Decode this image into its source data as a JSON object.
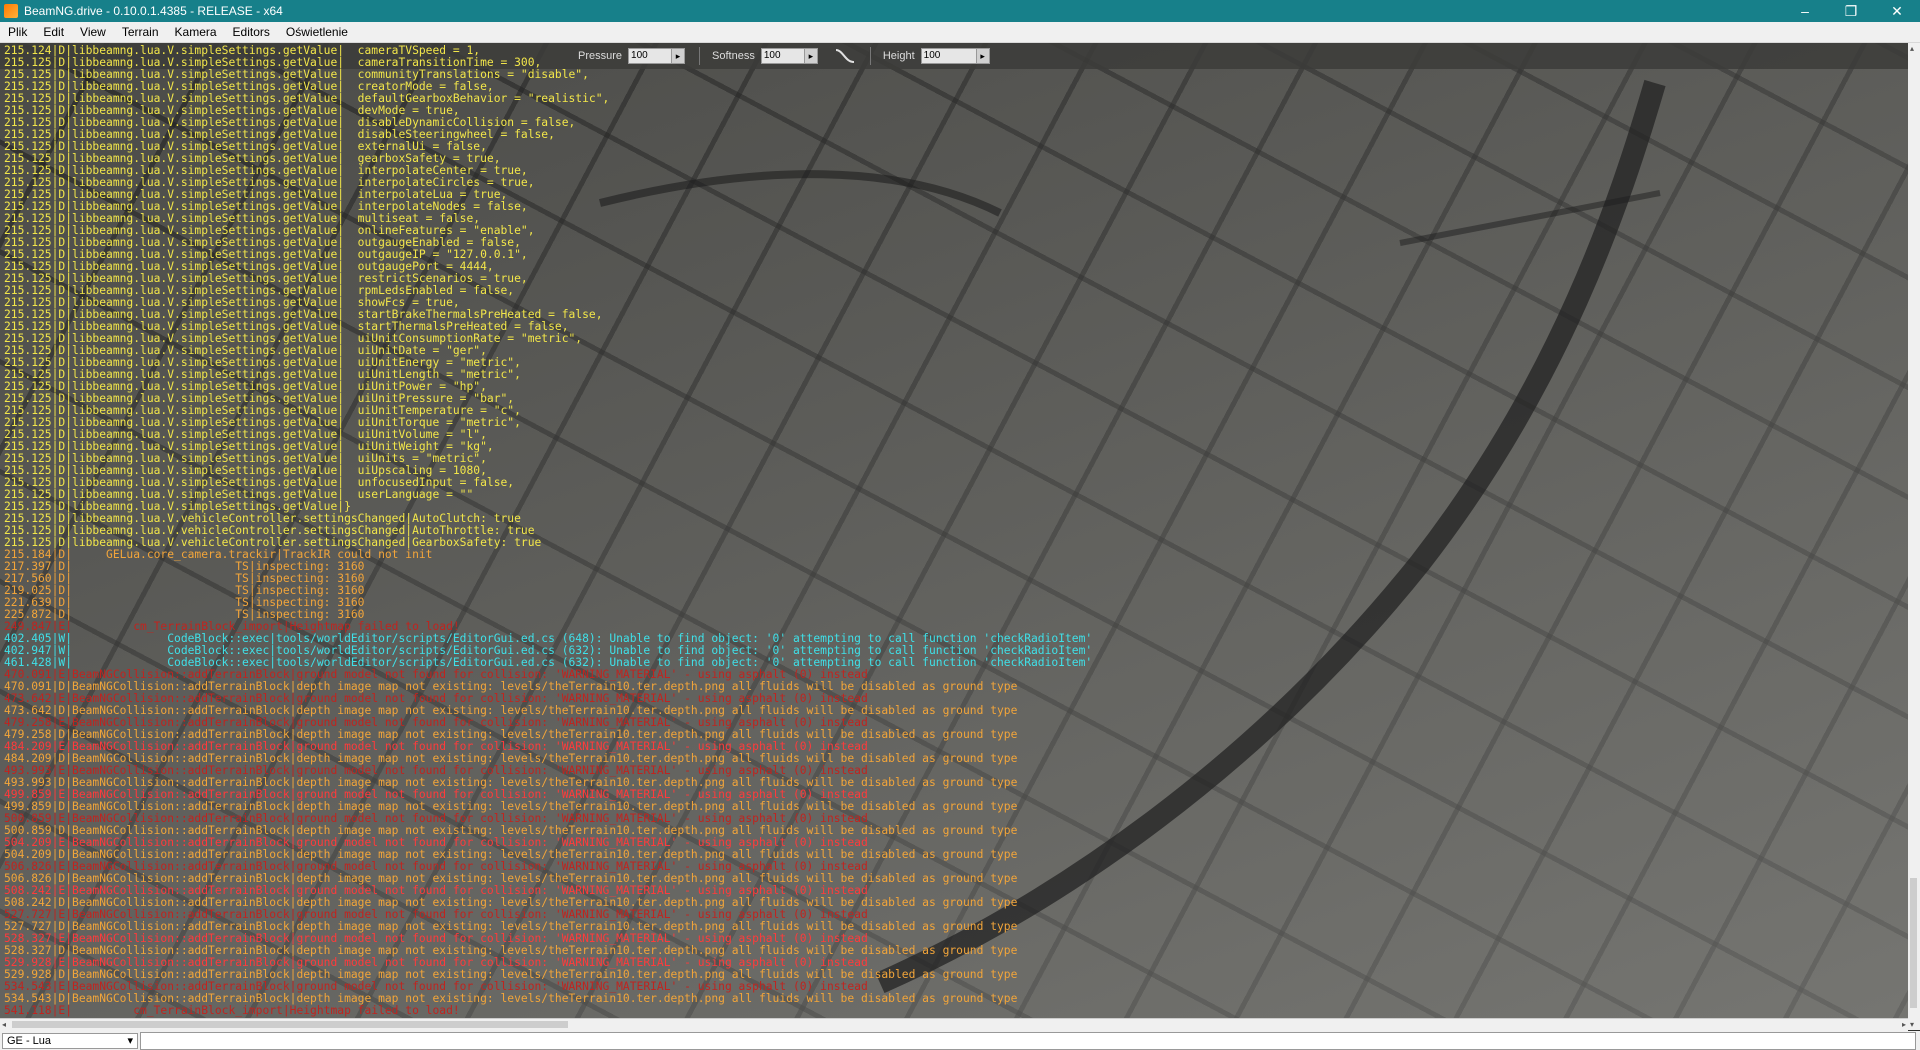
{
  "window": {
    "title": "BeamNG.drive - 0.10.0.1.4385 - RELEASE - x64",
    "minimize": "–",
    "maximize": "❐",
    "close": "✕"
  },
  "menu": [
    "Plik",
    "Edit",
    "View",
    "Terrain",
    "Kamera",
    "Editors",
    "Oświetlenie"
  ],
  "toolbar": {
    "pressure": {
      "label": "Pressure",
      "value": "100"
    },
    "softness": {
      "label": "Softness",
      "value": "100"
    },
    "height": {
      "label": "Height",
      "value": "100"
    }
  },
  "console_lines": [
    {
      "t": "215.124|D|libbeamng.lua.V.simpleSettings.getValue|  cameraTVSpeed = 1,",
      "c": "y"
    },
    {
      "t": "215.125|D|libbeamng.lua.V.simpleSettings.getValue|  cameraTransitionTime = 300,",
      "c": "y"
    },
    {
      "t": "215.125|D|libbeamng.lua.V.simpleSettings.getValue|  communityTranslations = \"disable\",",
      "c": "y"
    },
    {
      "t": "215.125|D|libbeamng.lua.V.simpleSettings.getValue|  creatorMode = false,",
      "c": "y"
    },
    {
      "t": "215.125|D|libbeamng.lua.V.simpleSettings.getValue|  defaultGearboxBehavior = \"realistic\",",
      "c": "y"
    },
    {
      "t": "215.125|D|libbeamng.lua.V.simpleSettings.getValue|  devMode = true,",
      "c": "y"
    },
    {
      "t": "215.125|D|libbeamng.lua.V.simpleSettings.getValue|  disableDynamicCollision = false,",
      "c": "y"
    },
    {
      "t": "215.125|D|libbeamng.lua.V.simpleSettings.getValue|  disableSteeringwheel = false,",
      "c": "y"
    },
    {
      "t": "215.125|D|libbeamng.lua.V.simpleSettings.getValue|  externalUi = false,",
      "c": "y"
    },
    {
      "t": "215.125|D|libbeamng.lua.V.simpleSettings.getValue|  gearboxSafety = true,",
      "c": "y"
    },
    {
      "t": "215.125|D|libbeamng.lua.V.simpleSettings.getValue|  interpolateCenter = true,",
      "c": "y"
    },
    {
      "t": "215.125|D|libbeamng.lua.V.simpleSettings.getValue|  interpolateCircles = true,",
      "c": "y"
    },
    {
      "t": "215.125|D|libbeamng.lua.V.simpleSettings.getValue|  interpolateLua = true,",
      "c": "y"
    },
    {
      "t": "215.125|D|libbeamng.lua.V.simpleSettings.getValue|  interpolateNodes = false,",
      "c": "y"
    },
    {
      "t": "215.125|D|libbeamng.lua.V.simpleSettings.getValue|  multiseat = false,",
      "c": "y"
    },
    {
      "t": "215.125|D|libbeamng.lua.V.simpleSettings.getValue|  onlineFeatures = \"enable\",",
      "c": "y"
    },
    {
      "t": "215.125|D|libbeamng.lua.V.simpleSettings.getValue|  outgaugeEnabled = false,",
      "c": "y"
    },
    {
      "t": "215.125|D|libbeamng.lua.V.simpleSettings.getValue|  outgaugeIP = \"127.0.0.1\",",
      "c": "y"
    },
    {
      "t": "215.125|D|libbeamng.lua.V.simpleSettings.getValue|  outgaugePort = 4444,",
      "c": "y"
    },
    {
      "t": "215.125|D|libbeamng.lua.V.simpleSettings.getValue|  restrictScenarios = true,",
      "c": "y"
    },
    {
      "t": "215.125|D|libbeamng.lua.V.simpleSettings.getValue|  rpmLedsEnabled = false,",
      "c": "y"
    },
    {
      "t": "215.125|D|libbeamng.lua.V.simpleSettings.getValue|  showFcs = true,",
      "c": "y"
    },
    {
      "t": "215.125|D|libbeamng.lua.V.simpleSettings.getValue|  startBrakeThermalsPreHeated = false,",
      "c": "y"
    },
    {
      "t": "215.125|D|libbeamng.lua.V.simpleSettings.getValue|  startThermalsPreHeated = false,",
      "c": "y"
    },
    {
      "t": "215.125|D|libbeamng.lua.V.simpleSettings.getValue|  uiUnitConsumptionRate = \"metric\",",
      "c": "y"
    },
    {
      "t": "215.125|D|libbeamng.lua.V.simpleSettings.getValue|  uiUnitDate = \"ger\",",
      "c": "y"
    },
    {
      "t": "215.125|D|libbeamng.lua.V.simpleSettings.getValue|  uiUnitEnergy = \"metric\",",
      "c": "y"
    },
    {
      "t": "215.125|D|libbeamng.lua.V.simpleSettings.getValue|  uiUnitLength = \"metric\",",
      "c": "y"
    },
    {
      "t": "215.125|D|libbeamng.lua.V.simpleSettings.getValue|  uiUnitPower = \"hp\",",
      "c": "y"
    },
    {
      "t": "215.125|D|libbeamng.lua.V.simpleSettings.getValue|  uiUnitPressure = \"bar\",",
      "c": "y"
    },
    {
      "t": "215.125|D|libbeamng.lua.V.simpleSettings.getValue|  uiUnitTemperature = \"c\",",
      "c": "y"
    },
    {
      "t": "215.125|D|libbeamng.lua.V.simpleSettings.getValue|  uiUnitTorque = \"metric\",",
      "c": "y"
    },
    {
      "t": "215.125|D|libbeamng.lua.V.simpleSettings.getValue|  uiUnitVolume = \"l\",",
      "c": "y"
    },
    {
      "t": "215.125|D|libbeamng.lua.V.simpleSettings.getValue|  uiUnitWeight = \"kg\",",
      "c": "y"
    },
    {
      "t": "215.125|D|libbeamng.lua.V.simpleSettings.getValue|  uiUnits = \"metric\",",
      "c": "y"
    },
    {
      "t": "215.125|D|libbeamng.lua.V.simpleSettings.getValue|  uiUpscaling = 1080,",
      "c": "y"
    },
    {
      "t": "215.125|D|libbeamng.lua.V.simpleSettings.getValue|  unfocusedInput = false,",
      "c": "y"
    },
    {
      "t": "215.125|D|libbeamng.lua.V.simpleSettings.getValue|  userLanguage = \"\"",
      "c": "y"
    },
    {
      "t": "215.125|D|libbeamng.lua.V.simpleSettings.getValue|}",
      "c": "y"
    },
    {
      "t": "215.125|D|libbeamng.lua.V.vehicleController.settingsChanged|AutoClutch: true",
      "c": "y"
    },
    {
      "t": "215.125|D|libbeamng.lua.V.vehicleController.settingsChanged|AutoThrottle: true",
      "c": "y"
    },
    {
      "t": "215.125|D|libbeamng.lua.V.vehicleController.settingsChanged|GearboxSafety: true",
      "c": "y"
    },
    {
      "t": "215.184|D|     GELua.core_camera.trackir|TrackIR could not init",
      "c": "o"
    },
    {
      "t": "217.397|D|                        TS|inspecting: 3160",
      "c": "o"
    },
    {
      "t": "217.560|D|                        TS|inspecting: 3160",
      "c": "o"
    },
    {
      "t": "219.025|D|                        TS|inspecting: 3160",
      "c": "o"
    },
    {
      "t": "221.639|D|                        TS|inspecting: 3160",
      "c": "o"
    },
    {
      "t": "225.872|D|                        TS|inspecting: 3160",
      "c": "o"
    },
    {
      "t": "249.847|E|         cm_TerrainBlock_import|Heightmap failed to load!",
      "c": "rd"
    },
    {
      "t": "402.405|W|              CodeBlock::exec|tools/worldEditor/scripts/EditorGui.ed.cs (648): Unable to find object: '0' attempting to call function 'checkRadioItem'",
      "c": "c"
    },
    {
      "t": "402.947|W|              CodeBlock::exec|tools/worldEditor/scripts/EditorGui.ed.cs (632): Unable to find object: '0' attempting to call function 'checkRadioItem'",
      "c": "c"
    },
    {
      "t": "461.428|W|              CodeBlock::exec|tools/worldEditor/scripts/EditorGui.ed.cs (632): Unable to find object: '0' attempting to call function 'checkRadioItem'",
      "c": "c"
    },
    {
      "t": "470.091|E|BeamNGCollision::addTerrainBlock|ground model not found for collision: 'WARNING_MATERIAL' - using asphalt (0) instead",
      "c": "rd"
    },
    {
      "t": "470.091|D|BeamNGCollision::addTerrainBlock|depth image map not existing: levels/theTerrain10.ter.depth.png all fluids will be disabled as ground type",
      "c": "o"
    },
    {
      "t": "473.642|E|BeamNGCollision::addTerrainBlock|ground model not found for collision: 'WARNING_MATERIAL' - using asphalt (0) instead",
      "c": "rd"
    },
    {
      "t": "473.642|D|BeamNGCollision::addTerrainBlock|depth image map not existing: levels/theTerrain10.ter.depth.png all fluids will be disabled as ground type",
      "c": "o"
    },
    {
      "t": "479.258|E|BeamNGCollision::addTerrainBlock|ground model not found for collision: 'WARNING_MATERIAL' - using asphalt (0) instead",
      "c": "rd"
    },
    {
      "t": "479.258|D|BeamNGCollision::addTerrainBlock|depth image map not existing: levels/theTerrain10.ter.depth.png all fluids will be disabled as ground type",
      "c": "o"
    },
    {
      "t": "484.209|E|BeamNGCollision::addTerrainBlock|ground model not found for collision: 'WARNING_MATERIAL' - using asphalt (0) instead",
      "c": "r"
    },
    {
      "t": "484.209|D|BeamNGCollision::addTerrainBlock|depth image map not existing: levels/theTerrain10.ter.depth.png all fluids will be disabled as ground type",
      "c": "o"
    },
    {
      "t": "493.993|E|BeamNGCollision::addTerrainBlock|ground model not found for collision: 'WARNING_MATERIAL' - using asphalt (0) instead",
      "c": "rd"
    },
    {
      "t": "493.993|D|BeamNGCollision::addTerrainBlock|depth image map not existing: levels/theTerrain10.ter.depth.png all fluids will be disabled as ground type",
      "c": "o"
    },
    {
      "t": "499.859|E|BeamNGCollision::addTerrainBlock|ground model not found for collision: 'WARNING_MATERIAL' - using asphalt (0) instead",
      "c": "r"
    },
    {
      "t": "499.859|D|BeamNGCollision::addTerrainBlock|depth image map not existing: levels/theTerrain10.ter.depth.png all fluids will be disabled as ground type",
      "c": "o"
    },
    {
      "t": "500.859|E|BeamNGCollision::addTerrainBlock|ground model not found for collision: 'WARNING_MATERIAL' - using asphalt (0) instead",
      "c": "rd"
    },
    {
      "t": "500.859|D|BeamNGCollision::addTerrainBlock|depth image map not existing: levels/theTerrain10.ter.depth.png all fluids will be disabled as ground type",
      "c": "o"
    },
    {
      "t": "504.209|E|BeamNGCollision::addTerrainBlock|ground model not found for collision: 'WARNING_MATERIAL' - using asphalt (0) instead",
      "c": "r"
    },
    {
      "t": "504.209|D|BeamNGCollision::addTerrainBlock|depth image map not existing: levels/theTerrain10.ter.depth.png all fluids will be disabled as ground type",
      "c": "o"
    },
    {
      "t": "506.826|E|BeamNGCollision::addTerrainBlock|ground model not found for collision: 'WARNING_MATERIAL' - using asphalt (0) instead",
      "c": "rd"
    },
    {
      "t": "506.826|D|BeamNGCollision::addTerrainBlock|depth image map not existing: levels/theTerrain10.ter.depth.png all fluids will be disabled as ground type",
      "c": "o"
    },
    {
      "t": "508.242|E|BeamNGCollision::addTerrainBlock|ground model not found for collision: 'WARNING_MATERIAL' - using asphalt (0) instead",
      "c": "r"
    },
    {
      "t": "508.242|D|BeamNGCollision::addTerrainBlock|depth image map not existing: levels/theTerrain10.ter.depth.png all fluids will be disabled as ground type",
      "c": "o"
    },
    {
      "t": "527.727|E|BeamNGCollision::addTerrainBlock|ground model not found for collision: 'WARNING_MATERIAL' - using asphalt (0) instead",
      "c": "rd"
    },
    {
      "t": "527.727|D|BeamNGCollision::addTerrainBlock|depth image map not existing: levels/theTerrain10.ter.depth.png all fluids will be disabled as ground type",
      "c": "o"
    },
    {
      "t": "528.327|E|BeamNGCollision::addTerrainBlock|ground model not found for collision: 'WARNING_MATERIAL' - using asphalt (0) instead",
      "c": "r"
    },
    {
      "t": "528.327|D|BeamNGCollision::addTerrainBlock|depth image map not existing: levels/theTerrain10.ter.depth.png all fluids will be disabled as ground type",
      "c": "o"
    },
    {
      "t": "529.928|E|BeamNGCollision::addTerrainBlock|ground model not found for collision: 'WARNING_MATERIAL' - using asphalt (0) instead",
      "c": "r"
    },
    {
      "t": "529.928|D|BeamNGCollision::addTerrainBlock|depth image map not existing: levels/theTerrain10.ter.depth.png all fluids will be disabled as ground type",
      "c": "o"
    },
    {
      "t": "534.543|E|BeamNGCollision::addTerrainBlock|ground model not found for collision: 'WARNING_MATERIAL' - using asphalt (0) instead",
      "c": "rd"
    },
    {
      "t": "534.543|D|BeamNGCollision::addTerrainBlock|depth image map not existing: levels/theTerrain10.ter.depth.png all fluids will be disabled as ground type",
      "c": "o"
    },
    {
      "t": "541.118|E|         cm_TerrainBlock_import|Heightmap failed to load!",
      "c": "rd"
    }
  ],
  "bottom": {
    "console_select": "GE - Lua",
    "dropdown_arrow": "▾"
  },
  "icons": {
    "app": "beamng-logo-icon",
    "curve": "brush-curve-icon"
  }
}
